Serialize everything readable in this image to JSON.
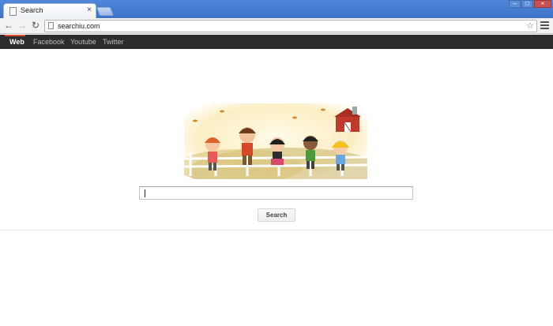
{
  "browser": {
    "tab_title": "Search",
    "tab_close": "×",
    "url": "searchiu.com",
    "window_controls": [
      "‒",
      "□",
      "×"
    ]
  },
  "toolbar": {
    "back": "←",
    "forward": "→",
    "reload": "↻",
    "star": "☆"
  },
  "navbar": {
    "links": [
      "Web",
      "Facebook",
      "Youtube",
      "Twitter"
    ],
    "active_index": 0,
    "accent_color": "#dd4b39"
  },
  "search": {
    "input_value": "",
    "button_label": "Search"
  },
  "icons": [
    "page-icon",
    "back-icon",
    "forward-icon",
    "reload-icon",
    "star-icon",
    "menu-icon",
    "close-icon"
  ]
}
